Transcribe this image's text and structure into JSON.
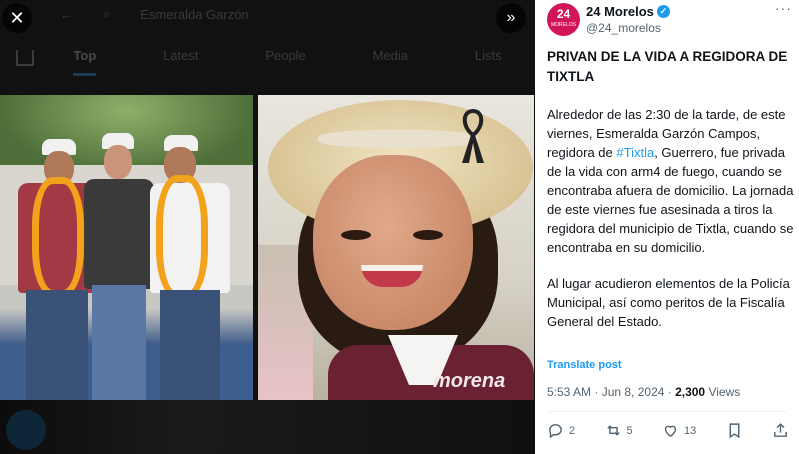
{
  "background": {
    "search_text": "Esmeralda Garzón",
    "tabs": [
      "Top",
      "Latest",
      "People",
      "Media",
      "Lists"
    ],
    "active_tab": "Top"
  },
  "media": {
    "close_icon": "close-icon",
    "expand_icon": "double-chevron-right-icon",
    "photo2_logo": "morena"
  },
  "post": {
    "avatar_top": "24",
    "avatar_sub": "MORELOS",
    "author_name": "24 Morelos",
    "handle": "@24_morelos",
    "title": "PRIVAN DE LA VIDA A REGIDORA DE TIXTLA",
    "para1_before": "Alrededor de las 2:30 de la tarde, de este viernes, Esmeralda Garzón Campos, regidora de ",
    "hashtag": "#Tixtla",
    "para1_after": ", Guerrero, fue privada de la vida con arm4 de fuego, cuando se encontraba afuera de domicilio. La jornada de este viernes fue asesinada a tiros la regidora del municipio de Tixtla, cuando se encontraba en su domicilio.",
    "para2": "Al lugar acudieron elementos de la Policía Municipal, así como peritos de la Fiscalía General del Estado.",
    "translate": "Translate post",
    "time": "5:53 AM · Jun 8, 2024 · ",
    "views_count": "2,300",
    "views_label": " Views",
    "replies": "2",
    "reposts": "5",
    "likes": "13",
    "colors": {
      "link": "#1d9bf0",
      "avatar": "#d2145a",
      "muted": "#536471"
    }
  }
}
